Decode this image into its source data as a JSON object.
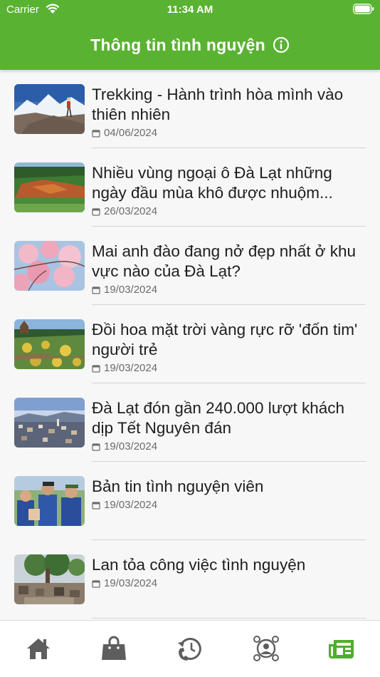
{
  "status_bar": {
    "carrier": "Carrier",
    "time": "11:34 AM"
  },
  "header": {
    "title": "Thông tin tình nguyện"
  },
  "news": [
    {
      "title": "Trekking - Hành trình hòa mình vào thiên nhiên",
      "date": "04/06/2024",
      "image": "mountain-trekker"
    },
    {
      "title": "Nhiều vùng ngoại ô Đà Lạt những ngày đầu mùa khô được nhuộm...",
      "date": "26/03/2024",
      "image": "forest-hill"
    },
    {
      "title": "Mai anh đào đang nở đẹp nhất ở khu vực nào của Đà Lạt?",
      "date": "19/03/2024",
      "image": "cherry-blossom"
    },
    {
      "title": "Đồi hoa mặt trời vàng rực rỡ 'đốn tim' người trẻ",
      "date": "19/03/2024",
      "image": "sunflower-hill"
    },
    {
      "title": "Đà Lạt đón gần 240.000 lượt khách dịp Tết Nguyên đán",
      "date": "19/03/2024",
      "image": "city-view"
    },
    {
      "title": "Bản tin tình nguyện viên",
      "date": "19/03/2024",
      "image": "volunteers"
    },
    {
      "title": "Lan tỏa công việc tình nguyện",
      "date": "19/03/2024",
      "image": "village-tree"
    }
  ],
  "tabs": [
    {
      "name": "home-icon",
      "active": false
    },
    {
      "name": "shopping-bag-icon",
      "active": false
    },
    {
      "name": "phone-history-icon",
      "active": false
    },
    {
      "name": "community-icon",
      "active": false
    },
    {
      "name": "news-icon",
      "active": true
    }
  ],
  "colors": {
    "brand_green": "#5ab232",
    "tab_gray": "#5e5e5e"
  }
}
